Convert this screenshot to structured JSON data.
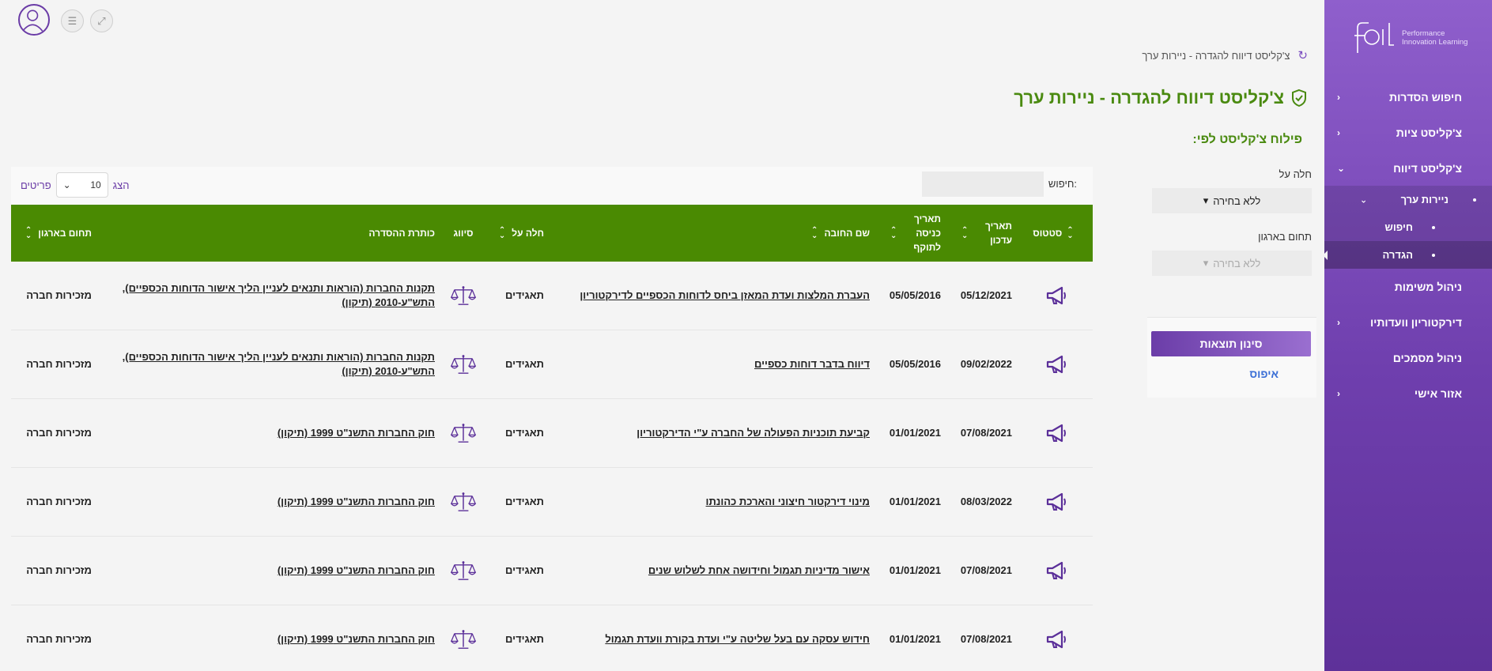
{
  "sidebar": {
    "logo_line1": "Performance",
    "logo_line2": "Innovation Learning",
    "items": [
      {
        "label": "חיפוש הסדרות"
      },
      {
        "label": "צ'קליסט ציות"
      },
      {
        "label": "צ'קליסט דיווח"
      },
      {
        "label": "ניירות ערך"
      },
      {
        "label": "חיפוש"
      },
      {
        "label": "הגדרה"
      },
      {
        "label": "ניהול משימות"
      },
      {
        "label": "דירקטוריון וועדותיו"
      },
      {
        "label": "ניהול מסמכים"
      },
      {
        "label": "אזור אישי"
      }
    ]
  },
  "header": {
    "breadcrumb": "צ'קליסט דיווח להגדרה - ניירות ערך",
    "title": "צ'קליסט דיווח להגדרה - ניירות ערך"
  },
  "filter": {
    "title": "פילוח צ'קליסט לפי:",
    "applies_label": "חלה על",
    "applies_value": "ללא בחירה",
    "domain_label": "תחום בארגון",
    "domain_value": "ללא בחירה",
    "filter_button": "סינון תוצאות",
    "reset_link": "איפוס"
  },
  "table_controls": {
    "search_label": "חיפוש:",
    "show_label": "הצג",
    "page_size": "10",
    "items_label": "פריטים"
  },
  "table": {
    "headers": {
      "status": "סטטוס",
      "updated": "תאריך עדכון",
      "entry": "תאריך כניסה לתוקף",
      "name": "שם החובה",
      "applies": "חלה על",
      "class": "סיווג",
      "title": "כותרת ההסדרה",
      "domain": "תחום בארגון"
    },
    "rows": [
      {
        "updated": "05/12/2021",
        "entry": "05/05/2016",
        "name": "העברת המלצות ועדת המאזן ביחס לדוחות הכספיים לדירקטוריון",
        "applies": "תאגידים",
        "title": "תקנות החברות (הוראות ותנאים לעניין הליך אישור הדוחות הכספיים), התש\"ע-2010 (תיקון)",
        "domain": "מזכירות חברה"
      },
      {
        "updated": "09/02/2022",
        "entry": "05/05/2016",
        "name": "דיווח בדבר דוחות כספיים",
        "applies": "תאגידים",
        "title": "תקנות החברות (הוראות ותנאים לעניין הליך אישור הדוחות הכספיים), התש\"ע-2010 (תיקון)",
        "domain": "מזכירות חברה"
      },
      {
        "updated": "07/08/2021",
        "entry": "01/01/2021",
        "name": "קביעת תוכניות הפעולה של החברה ע\"י הדירקטוריון",
        "applies": "תאגידים",
        "title": "חוק החברות התשנ\"ט 1999 (תיקון)",
        "domain": "מזכירות חברה"
      },
      {
        "updated": "08/03/2022",
        "entry": "01/01/2021",
        "name": "מינוי דירקטור חיצוני והארכת כהונתו",
        "applies": "תאגידים",
        "title": "חוק החברות התשנ\"ט 1999 (תיקון)",
        "domain": "מזכירות חברה"
      },
      {
        "updated": "07/08/2021",
        "entry": "01/01/2021",
        "name": "אישור מדיניות תגמול וחידושה אחת לשלוש שנים",
        "applies": "תאגידים",
        "title": "חוק החברות התשנ\"ט 1999 (תיקון)",
        "domain": "מזכירות חברה"
      },
      {
        "updated": "07/08/2021",
        "entry": "01/01/2021",
        "name": "חידוש עסקה עם בעל שליטה ע\"י ועדת בקורת וועדת תגמול",
        "applies": "תאגידים",
        "title": "חוק החברות התשנ\"ט 1999 (תיקון)",
        "domain": "מזכירות חברה"
      }
    ]
  },
  "colors": {
    "brand_purple": "#6f3fae",
    "header_green": "#4a8a02",
    "title_green": "#4a8a10",
    "link_blue": "#3b6fd6"
  },
  "icons": [
    "user-icon",
    "menu-icon",
    "fullscreen-icon",
    "refresh-icon",
    "shield-check-icon",
    "megaphone-icon",
    "scales-icon",
    "chevron-icon",
    "sort-icon"
  ]
}
